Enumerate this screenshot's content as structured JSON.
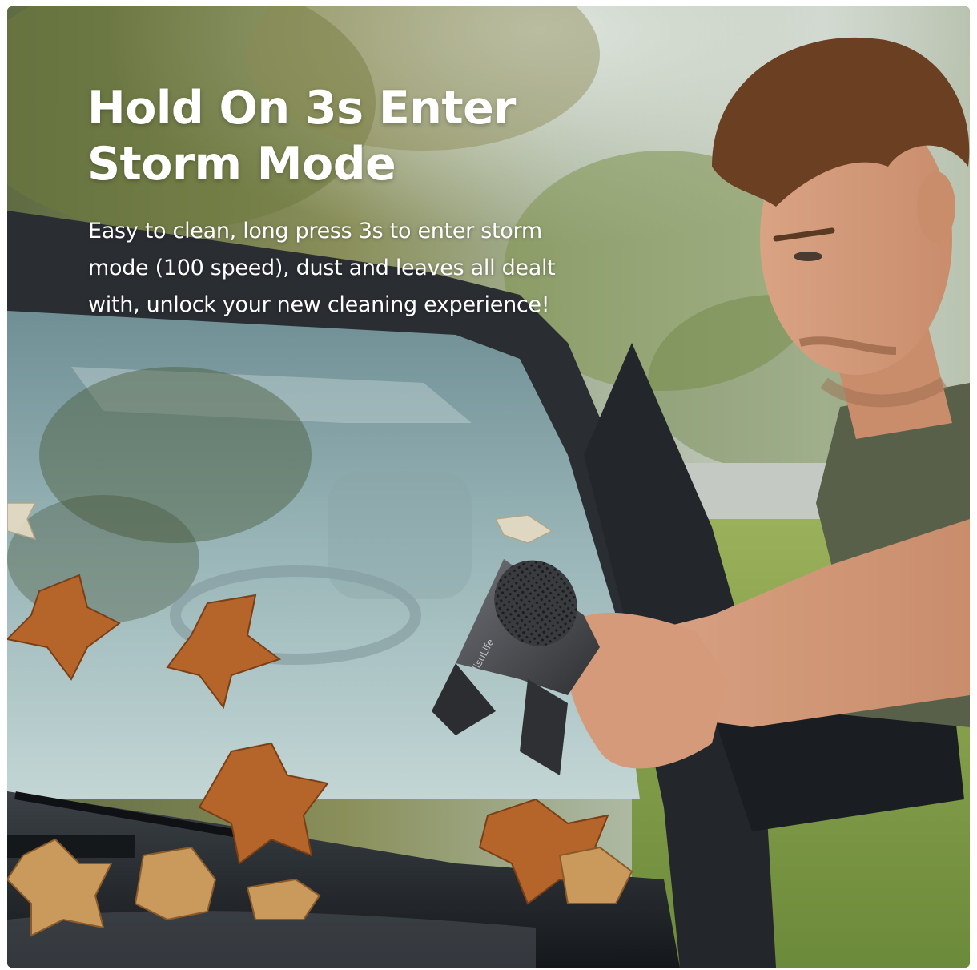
{
  "banner": {
    "headline_line1": "Hold On 3s Enter",
    "headline_line2": "Storm Mode",
    "body_line1": "Easy to clean, long press 3s to enter storm",
    "body_line2": "mode (100 speed), dust and leaves all dealt",
    "body_line3": "with, unlock your new cleaning experience!"
  },
  "product": {
    "brand_mark": "JisuLife",
    "icon": "air-duster-blower"
  },
  "colors": {
    "text": "#ffffff",
    "car_body": "#2a2e33",
    "leaf": "#b5652a",
    "foliage": "#7d8a4a",
    "shirt": "#59604a",
    "device": "#4a4b4f"
  }
}
